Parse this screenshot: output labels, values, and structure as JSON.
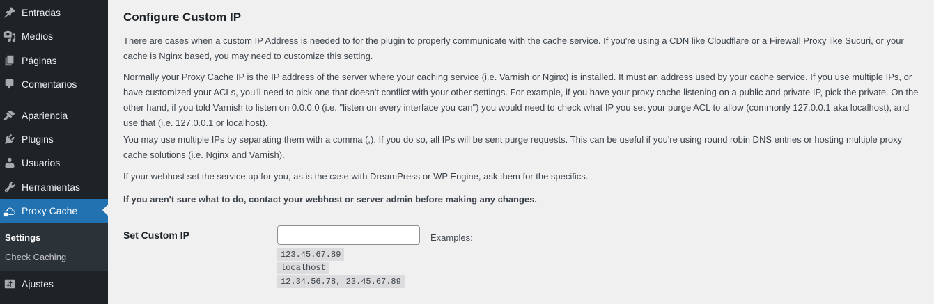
{
  "sidebar": {
    "items": [
      {
        "label": "Entradas",
        "icon": "pin-icon"
      },
      {
        "label": "Medios",
        "icon": "media-icon"
      },
      {
        "label": "Páginas",
        "icon": "pages-icon"
      },
      {
        "label": "Comentarios",
        "icon": "comment-icon"
      },
      {
        "label": "Apariencia",
        "icon": "brush-icon"
      },
      {
        "label": "Plugins",
        "icon": "plug-icon"
      },
      {
        "label": "Usuarios",
        "icon": "user-icon"
      },
      {
        "label": "Herramientas",
        "icon": "wrench-icon"
      },
      {
        "label": "Proxy Cache",
        "icon": "cloud-icon",
        "active": true
      },
      {
        "label": "Ajustes",
        "icon": "settings-icon"
      }
    ],
    "submenu": [
      {
        "label": "Settings",
        "current": true
      },
      {
        "label": "Check Caching"
      }
    ]
  },
  "main": {
    "title": "Configure Custom IP",
    "paragraphs": [
      "There are cases when a custom IP Address is needed to for the plugin to properly communicate with the cache service. If you're using a CDN like Cloudflare or a Firewall Proxy like Sucuri, or your cache is Nginx based, you may need to customize this setting.",
      "Normally your Proxy Cache IP is the IP address of the server where your caching service (i.e. Varnish or Nginx) is installed. It must an address used by your cache service. If you use multiple IPs, or have customized your ACLs, you'll need to pick one that doesn't conflict with your other settings. For example, if you have your proxy cache listening on a public and private IP, pick the private. On the other hand, if you told Varnish to listen on 0.0.0.0 (i.e. \"listen on every interface you can\") you would need to check what IP you set your purge ACL to allow (commonly 127.0.0.1 aka localhost), and use that (i.e. 127.0.0.1 or localhost).",
      "You may use multiple IPs by separating them with a comma (,). If you do so, all IPs will be sent purge requests. This can be useful if you're using round robin DNS entries or hosting multiple proxy cache solutions (i.e. Nginx and Varnish).",
      "If your webhost set the service up for you, as is the case with DreamPress or WP Engine, ask them for the specifics."
    ],
    "warning": "If you aren't sure what to do, contact your webhost or server admin before making any changes.",
    "field_label": "Set Custom IP",
    "field_value": "",
    "examples_label": "Examples:",
    "examples": [
      "123.45.67.89",
      "localhost",
      "12.34.56.78, 23.45.67.89"
    ]
  }
}
